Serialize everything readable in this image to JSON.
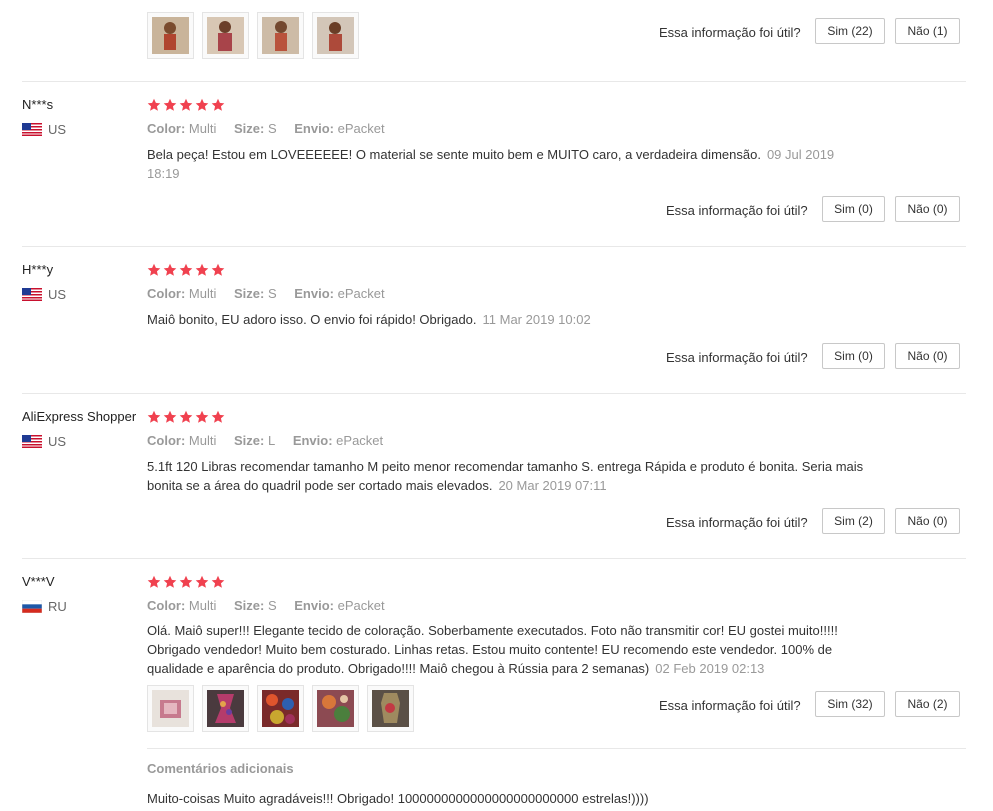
{
  "labels": {
    "helpful": "Essa informação foi útil?",
    "color": "Color:",
    "size": "Size:",
    "shipping": "Envio:",
    "additional_comments": "Comentários adicionais"
  },
  "colors": {
    "star": "#f0414f",
    "border": "#c8c8c8",
    "muted": "#999999"
  },
  "top": {
    "yes": "Sim (22)",
    "no": "Não (1)",
    "thumb_count": 4
  },
  "reviews": [
    {
      "name": "N***s",
      "country": "US",
      "flag": "us-flag-icon",
      "rating": 5,
      "color": "Multi",
      "size": "S",
      "shipping": "ePacket",
      "text": "Bela peça! Estou em LOVEEEEEE! O material se sente muito bem e MUITO caro, a verdadeira dimensão.",
      "date": "09 Jul 2019 18:19",
      "yes": "Sim (0)",
      "no": "Não (0)"
    },
    {
      "name": "H***y",
      "country": "US",
      "flag": "us-flag-icon",
      "rating": 5,
      "color": "Multi",
      "size": "S",
      "shipping": "ePacket",
      "text": "Maiô bonito, EU adoro isso. O envio foi rápido! Obrigado.",
      "date": "11 Mar 2019 10:02",
      "yes": "Sim (0)",
      "no": "Não (0)"
    },
    {
      "name": "AliExpress Shopper",
      "country": "US",
      "flag": "us-flag-icon",
      "rating": 5,
      "color": "Multi",
      "size": "L",
      "shipping": "ePacket",
      "text": "5.1ft 120 Libras recomendar tamanho M peito menor recomendar tamanho S. entrega Rápida e produto é bonita. Seria mais bonita se a área do quadril pode ser cortado mais elevados.",
      "date": "20 Mar 2019 07:11",
      "yes": "Sim (2)",
      "no": "Não (0)"
    },
    {
      "name": "V***V",
      "country": "RU",
      "flag": "ru-flag-icon",
      "rating": 5,
      "color": "Multi",
      "size": "S",
      "shipping": "ePacket",
      "text": "Olá. Maiô super!!! Elegante tecido de coloração. Soberbamente executados. Foto não transmitir cor! EU gostei muito!!!!! Obrigado vendedor! Muito bem costurado. Linhas retas. Estou muito contente! EU recomendo este vendedor. 100% de qualidade e aparência do produto. Obrigado!!!! Maiô chegou à Rússia para 2 semanas)",
      "date": "02 Feb 2019 02:13",
      "yes": "Sim (32)",
      "no": "Não (2)",
      "thumb_count": 5,
      "additional_text": "Muito-coisas Muito agradáveis!!! Obrigado! 1000000000000000000000000 estrelas!))))"
    }
  ]
}
